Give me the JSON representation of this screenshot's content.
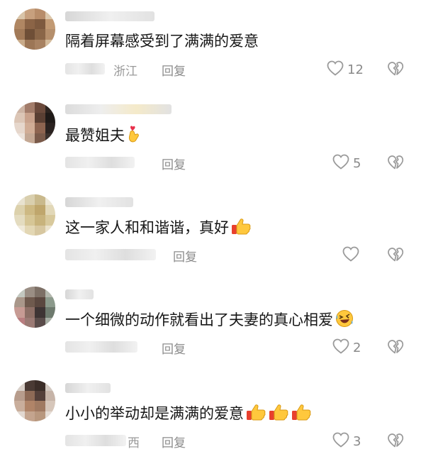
{
  "comments": [
    {
      "text": "隔着屏幕感受到了满满的爱意",
      "location": "浙江",
      "reply_label": "回复",
      "likes": "12",
      "emoji": []
    },
    {
      "text": "最赞姐夫",
      "location": "",
      "reply_label": "回复",
      "likes": "5",
      "emoji": [
        "finger-heart"
      ]
    },
    {
      "text": "这一家人和和谐谐，真好",
      "location": "",
      "reply_label": "回复",
      "likes": "",
      "emoji": [
        "thumbs-up"
      ]
    },
    {
      "text": "一个细微的动作就看出了夫妻的真心相爱",
      "location": "",
      "reply_label": "回复",
      "likes": "2",
      "emoji": [
        "rolling-laugh"
      ]
    },
    {
      "text": "小小的举动却是满满的爱意",
      "location": "西",
      "reply_label": "回复",
      "likes": "3",
      "emoji": [
        "thumbs-up",
        "thumbs-up",
        "thumbs-up"
      ]
    }
  ],
  "colors": {
    "text": "#161616",
    "muted": "#8c8c8c",
    "icon": "#a0a0a0"
  }
}
